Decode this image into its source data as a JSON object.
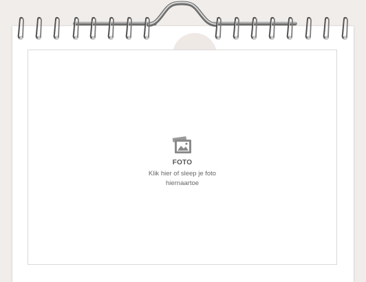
{
  "photo_placeholder": {
    "icon": "photo-icon",
    "title": "FOTO",
    "hint": "Klik hier of sleep je foto hiernaartoe"
  },
  "colors": {
    "background": "#f1edea",
    "page": "#ffffff",
    "frame_border": "#d9d9d9",
    "icon": "#8a8a8a",
    "text": "#555555"
  }
}
